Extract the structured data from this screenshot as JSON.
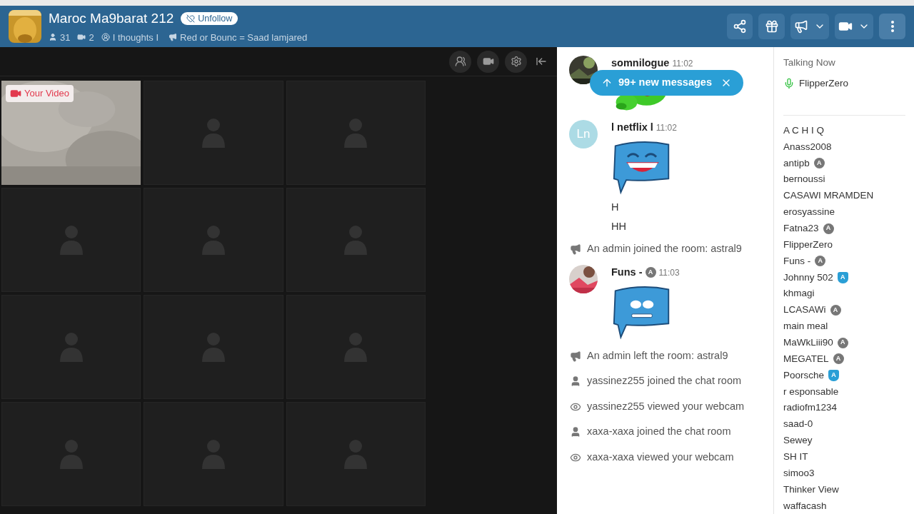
{
  "room": {
    "title": "Maroc Ma9barat 212",
    "follow_button": "Unfollow",
    "users": "31",
    "cams": "2",
    "status": "I thoughts I",
    "announcement": "Red or Bounc = Saad lamjared"
  },
  "video_tiles": [
    {
      "kind": "self",
      "label": "Your Video"
    },
    {
      "kind": "empty"
    },
    {
      "kind": "empty"
    },
    {
      "kind": "empty"
    },
    {
      "kind": "empty"
    },
    {
      "kind": "empty"
    },
    {
      "kind": "empty"
    },
    {
      "kind": "empty"
    },
    {
      "kind": "empty"
    },
    {
      "kind": "empty"
    },
    {
      "kind": "empty"
    },
    {
      "kind": "empty"
    }
  ],
  "new_messages_banner": "99+ new messages",
  "chat": [
    {
      "kind": "message",
      "name": "somnilogue",
      "time": "11:02",
      "content": [
        {
          "kind": "frog_sticker"
        }
      ]
    },
    {
      "kind": "message",
      "avatar": {
        "kind": "initials",
        "text": "Ln"
      },
      "name": "l netflix l",
      "time": "11:02",
      "content": [
        {
          "kind": "laughing_sticker"
        },
        {
          "kind": "text",
          "text": "H"
        },
        {
          "kind": "text",
          "text": "HH"
        }
      ]
    },
    {
      "kind": "admin_notice",
      "text": "An admin joined the room: astral9"
    },
    {
      "kind": "message",
      "name": "Funs -",
      "badge": {
        "kind": "admin",
        "label": "A"
      },
      "time": "11:03",
      "content": [
        {
          "kind": "worried_sticker"
        }
      ]
    },
    {
      "kind": "admin_notice",
      "text": "An admin left the room: astral9"
    },
    {
      "kind": "join",
      "text": "yassinez255 joined the chat room"
    },
    {
      "kind": "webcam_view",
      "text": "yassinez255 viewed your webcam"
    },
    {
      "kind": "join",
      "text": "xaxa-xaxa joined the chat room"
    },
    {
      "kind": "webcam_view",
      "text": "xaxa-xaxa viewed your webcam"
    }
  ],
  "talking_now": {
    "heading": "Talking Now",
    "users": [
      "FlipperZero"
    ]
  },
  "users": [
    {
      "name": "A C H I Q"
    },
    {
      "name": "Anass2008"
    },
    {
      "name": "antipb",
      "badge": {
        "kind": "admin",
        "label": "A"
      }
    },
    {
      "name": "bernoussi"
    },
    {
      "name": "CASAWI MRAMDEN"
    },
    {
      "name": "erosyassine"
    },
    {
      "name": "Fatna23",
      "badge": {
        "kind": "admin",
        "label": "A"
      }
    },
    {
      "name": "FlipperZero"
    },
    {
      "name": "Funs -",
      "badge": {
        "kind": "admin",
        "label": "A"
      }
    },
    {
      "name": "Johnny 502",
      "badge": {
        "kind": "moderator",
        "label": "A"
      }
    },
    {
      "name": "khmagi"
    },
    {
      "name": "LCASAWi",
      "badge": {
        "kind": "admin",
        "label": "A"
      }
    },
    {
      "name": "main meal"
    },
    {
      "name": "MaWkLiii90",
      "badge": {
        "kind": "admin",
        "label": "A"
      }
    },
    {
      "name": "MEGATEL",
      "badge": {
        "kind": "admin",
        "label": "A"
      }
    },
    {
      "name": "Poorsche",
      "badge": {
        "kind": "moderator",
        "label": "A"
      }
    },
    {
      "name": "r esponsable"
    },
    {
      "name": "radiofm1234"
    },
    {
      "name": "saad-0"
    },
    {
      "name": "Sewey"
    },
    {
      "name": "SH IT"
    },
    {
      "name": "simoo3"
    },
    {
      "name": "Thinker View"
    },
    {
      "name": "waffacash"
    }
  ]
}
